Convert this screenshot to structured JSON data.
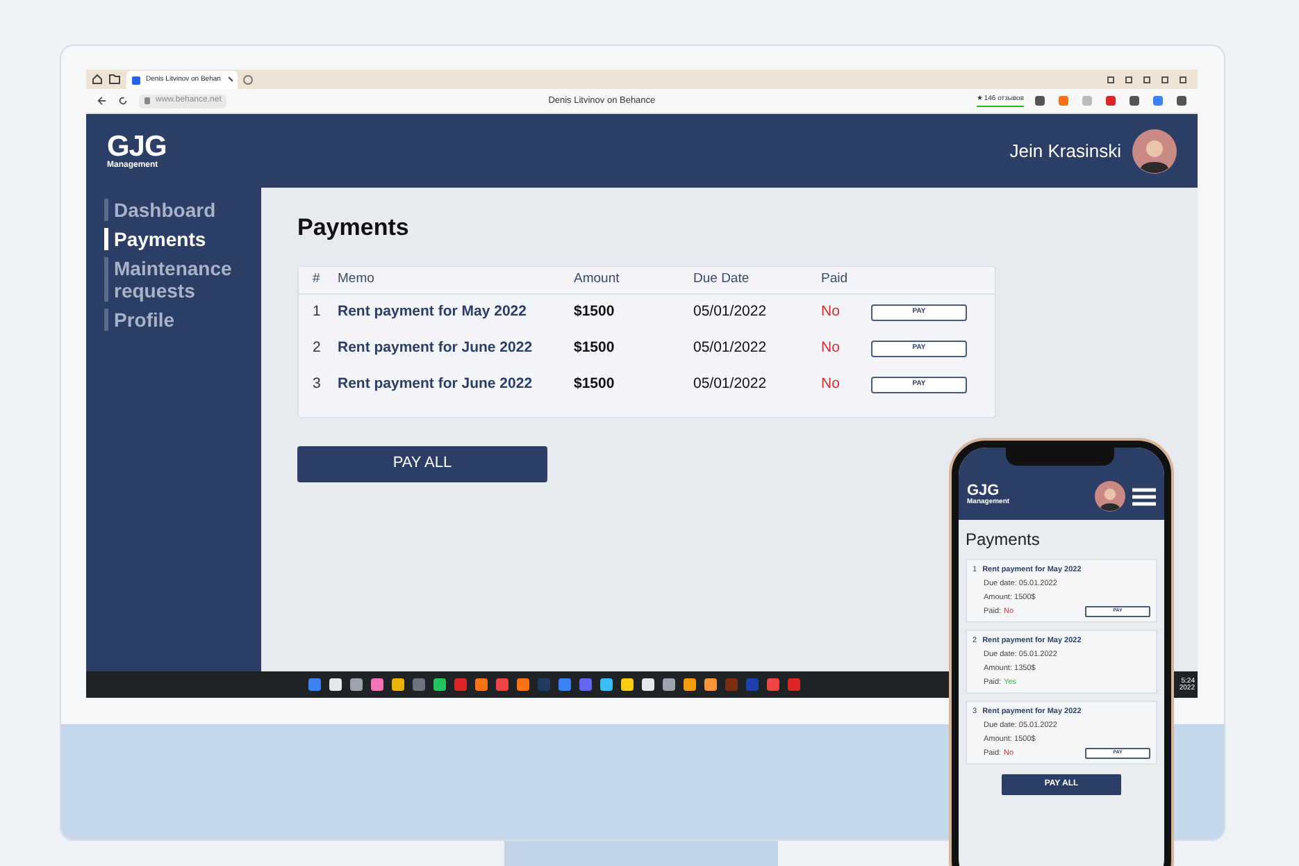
{
  "browser": {
    "tab_title": "Denis Litvinov on Behan",
    "url": "www.behance.net",
    "page_title": "Denis Litvinov on Behance",
    "reviews": "★ 146 отзывов"
  },
  "desktop_app": {
    "logo": "GJG",
    "logo_sub": "Management",
    "user_name": "Jein Krasinski",
    "nav": [
      {
        "label": "Dashboard",
        "selected": false
      },
      {
        "label": "Payments",
        "selected": true
      },
      {
        "label": "Maintenance requests",
        "selected": false
      },
      {
        "label": "Profile",
        "selected": false
      }
    ],
    "heading": "Payments",
    "table": {
      "columns": [
        "#",
        "Memo",
        "Amount",
        "Due Date",
        "Paid"
      ],
      "rows": [
        {
          "number": "1",
          "memo": "Rent payment for May 2022",
          "amount": "$1500",
          "due_date": "05/01/2022",
          "paid_text": "No",
          "paid": false,
          "button": "PAY"
        },
        {
          "number": "2",
          "memo": "Rent payment for June 2022",
          "amount": "$1500",
          "due_date": "05/01/2022",
          "paid_text": "No",
          "paid": false,
          "button": "PAY"
        },
        {
          "number": "3",
          "memo": "Rent payment for June 2022",
          "amount": "$1500",
          "due_date": "05/01/2022",
          "paid_text": "No",
          "paid": false,
          "button": "PAY"
        }
      ]
    },
    "pay_all": "PAY ALL"
  },
  "taskbar": {
    "time": "5:24",
    "date": "2022"
  },
  "mobile_app": {
    "logo": "GJG",
    "logo_sub": "Management",
    "heading": "Payments",
    "cards": [
      {
        "number": "1",
        "memo": "Rent payment for May 2022",
        "due_label": "Due date:",
        "due_date": "05.01.2022",
        "amount_label": "Amount:",
        "amount": "1500$",
        "paid_label": "Paid:",
        "paid_text": "No",
        "paid": false,
        "button": "PAY"
      },
      {
        "number": "2",
        "memo": "Rent payment for May 2022",
        "due_label": "Due date:",
        "due_date": "05.01.2022",
        "amount_label": "Amount:",
        "amount": "1350$",
        "paid_label": "Paid:",
        "paid_text": "Yes",
        "paid": true
      },
      {
        "number": "3",
        "memo": "Rent payment for May 2022",
        "due_label": "Due date:",
        "due_date": "05.01.2022",
        "amount_label": "Amount:",
        "amount": "1500$",
        "paid_label": "Paid:",
        "paid_text": "No",
        "paid": false,
        "button": "PAY"
      }
    ],
    "pay_all": "PAY ALL"
  }
}
